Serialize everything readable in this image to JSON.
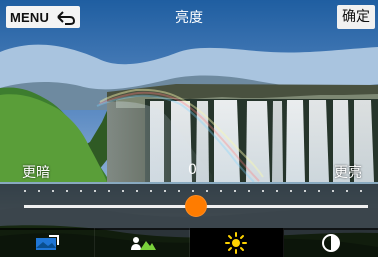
{
  "topbar": {
    "menu_label": "MENU",
    "title": "亮度",
    "ok_label": "确定"
  },
  "adjustment": {
    "left_label": "更暗",
    "right_label": "更亮",
    "value": "0",
    "level_fraction": 0.5
  },
  "tabs": [
    {
      "icon": "landscape-icon"
    },
    {
      "icon": "portrait-mountain-icon"
    },
    {
      "icon": "sun-icon"
    },
    {
      "icon": "contrast-icon"
    }
  ],
  "accent_color": "#ff7c00"
}
